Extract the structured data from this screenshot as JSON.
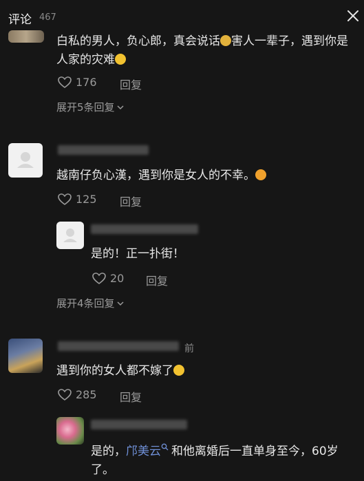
{
  "header": {
    "title": "评论",
    "count": "467"
  },
  "comments": [
    {
      "text_line1": "白私的男人，负心郎，真会说话",
      "text_line1_b": "害人一辈子，遇到你是",
      "text_line2": "人家的灾难",
      "likes": "176",
      "reply_label": "回复",
      "expand_label": "展开5条回复"
    },
    {
      "text": "越南仔负心漢，遇到你是女人的不幸。",
      "likes": "125",
      "reply_label": "回复",
      "replies": [
        {
          "text": "是的！正一扑街！",
          "likes": "20",
          "reply_label": "回复"
        }
      ],
      "expand_label": "展开4条回复"
    },
    {
      "time_suffix": "前",
      "text": "遇到你的女人都不嫁了",
      "likes": "285",
      "reply_label": "回复",
      "replies": [
        {
          "text_prefix": "是的，",
          "mention": "邝美云",
          "text_suffix": "和他离婚后一直单身至今，60岁",
          "text_line2": "了。"
        }
      ]
    }
  ],
  "icons": {
    "like": "heart-outline-icon",
    "close": "close-icon",
    "chevron": "chevron-down-icon",
    "thumbs_up": "thumbs-up-emoji",
    "laugh": "laughing-emoji",
    "angry": "angry-emoji",
    "search": "search-icon"
  },
  "colors": {
    "background": "#161616",
    "text": "#e8e8e8",
    "muted": "#9a9a9a",
    "mention": "#6f8fd6"
  }
}
